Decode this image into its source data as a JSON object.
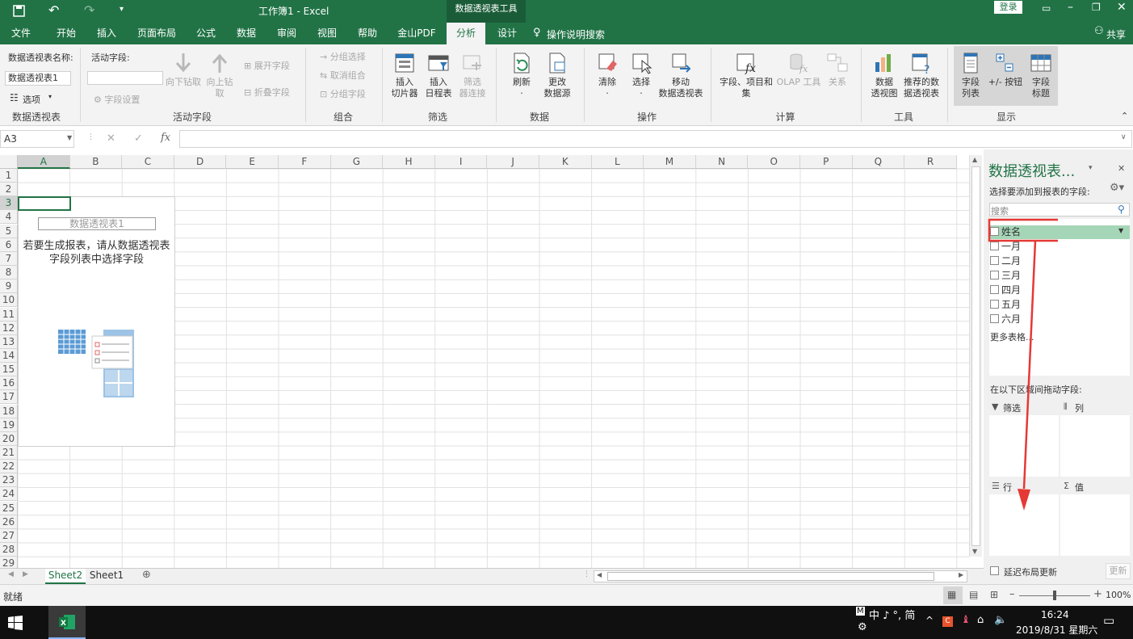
{
  "titlebar": {
    "title": "工作簿1  -  Excel",
    "context_tab": "数据透视表工具",
    "login": "登录"
  },
  "tabs": [
    "文件",
    "开始",
    "插入",
    "页面布局",
    "公式",
    "数据",
    "审阅",
    "视图",
    "帮助",
    "金山PDF",
    "分析",
    "设计"
  ],
  "tell_me": "操作说明搜索",
  "share": "共享",
  "ribbon": {
    "pivot": {
      "name_label": "数据透视表名称:",
      "name_value": "数据透视表1",
      "options": "选项",
      "group": "数据透视表"
    },
    "active_field": {
      "label": "活动字段:",
      "field_settings": "字段设置",
      "drill_down": "向下钻取",
      "drill_up_1": "向上钻",
      "drill_up_2": "取",
      "expand": "展开字段",
      "collapse": "折叠字段",
      "group": "活动字段"
    },
    "group_grp": {
      "group_sel": "分组选择",
      "ungroup": "取消组合",
      "group_field": "分组字段",
      "group": "组合"
    },
    "filter": {
      "slicer_1": "插入",
      "slicer_2": "切片器",
      "timeline_1": "插入",
      "timeline_2": "日程表",
      "conn_1": "筛选",
      "conn_2": "器连接",
      "group": "筛选"
    },
    "data": {
      "refresh": "刷新",
      "change_1": "更改",
      "change_2": "数据源",
      "group": "数据"
    },
    "actions": {
      "clear": "清除",
      "select": "选择",
      "move_1": "移动",
      "move_2": "数据透视表",
      "group": "操作"
    },
    "calc": {
      "fields_1": "字段、项目和",
      "fields_2": "集",
      "olap": "OLAP 工具",
      "rel": "关系",
      "group": "计算"
    },
    "tools": {
      "chart_1": "数据",
      "chart_2": "透视图",
      "rec_1": "推荐的数",
      "rec_2": "据透视表",
      "group": "工具"
    },
    "show": {
      "list_1": "字段",
      "list_2": "列表",
      "btn": "+/- 按钮",
      "hdr_1": "字段",
      "hdr_2": "标题",
      "group": "显示"
    }
  },
  "formula": {
    "namebox": "A3",
    "fx": "fx",
    "value": ""
  },
  "sheet": {
    "columns": [
      "A",
      "B",
      "C",
      "D",
      "E",
      "F",
      "G",
      "H",
      "I",
      "J",
      "K",
      "L",
      "M",
      "N",
      "O",
      "P",
      "Q",
      "R"
    ],
    "rows": [
      "1",
      "2",
      "3",
      "4",
      "5",
      "6",
      "7",
      "8",
      "9",
      "10",
      "11",
      "12",
      "13",
      "14",
      "15",
      "16",
      "17",
      "18",
      "19",
      "20",
      "21",
      "22",
      "23",
      "24",
      "25",
      "26",
      "27",
      "28",
      "29"
    ],
    "pivot_title": "数据透视表1",
    "pivot_hint_1": "若要生成报表，请从数据透视表",
    "pivot_hint_2": "字段列表中选择字段",
    "tabs": [
      "Sheet2",
      "Sheet1"
    ]
  },
  "pane": {
    "title": "数据透视表...",
    "choose_label": "选择要添加到报表的字段:",
    "search_placeholder": "搜索",
    "fields": [
      "姓名",
      "一月",
      "二月",
      "三月",
      "四月",
      "五月",
      "六月"
    ],
    "more": "更多表格...",
    "drag_label": "在以下区域间拖动字段:",
    "filter": "筛选",
    "columns": "列",
    "rows": "行",
    "values": "值",
    "defer": "延迟布局更新",
    "update": "更新"
  },
  "status": {
    "ready": "就绪",
    "zoom": "100%"
  },
  "taskbar": {
    "ime": "中 ♪ °, 简",
    "time": "16:24",
    "date": "2019/8/31 星期六"
  },
  "colors": {
    "excel_green": "#217346",
    "annotation_red": "#e53935",
    "selected_field": "#a5d6b8"
  }
}
